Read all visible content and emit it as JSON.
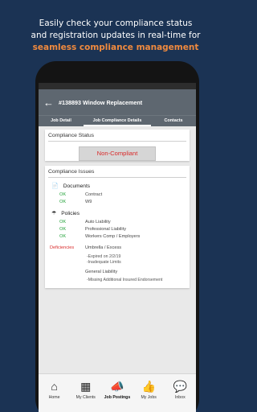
{
  "promo": {
    "line1": "Easily check your compliance status",
    "line2": "and registration updates in real-time for",
    "line3": "seamless compliance management"
  },
  "appbar": {
    "title": "#138893 Window Replacement"
  },
  "tabs": [
    {
      "label": "Job Detail"
    },
    {
      "label": "Job Compliance Details"
    },
    {
      "label": "Contacts"
    }
  ],
  "compliance_status": {
    "heading": "Compliance Status",
    "value": "Non-Compliant"
  },
  "compliance_issues": {
    "heading": "Compliance Issues",
    "documents": {
      "title": "Documents",
      "rows": [
        {
          "status": "OK",
          "label": "Contract"
        },
        {
          "status": "OK",
          "label": "W9"
        }
      ]
    },
    "policies": {
      "title": "Policies",
      "rows": [
        {
          "status": "OK",
          "label": "Auto Liability"
        },
        {
          "status": "OK",
          "label": "Professional Liability"
        },
        {
          "status": "OK",
          "label": "Workers Comp / Employers"
        }
      ],
      "deficiencies_label": "Deficiencies",
      "umbrella": {
        "label": "Umbrella / Excess",
        "notes": [
          "-Expired on 2/2/19",
          "-Inadequate Limits"
        ]
      },
      "general": {
        "label": "General Liability",
        "notes": [
          "-Missing Additional Insured Endorsement"
        ]
      }
    }
  },
  "nav": [
    {
      "label": "Home",
      "icon": "home-icon"
    },
    {
      "label": "My Clients",
      "icon": "building-icon"
    },
    {
      "label": "Job Postings",
      "icon": "megaphone-icon"
    },
    {
      "label": "My Jobs",
      "icon": "thumbs-up-icon"
    },
    {
      "label": "Inbox",
      "icon": "chat-icon"
    }
  ],
  "colors": {
    "background": "#1b3354",
    "accent": "#f08a3e",
    "appbar": "#5e6770",
    "ok": "#23a23a",
    "deficient": "#d92b2b"
  }
}
